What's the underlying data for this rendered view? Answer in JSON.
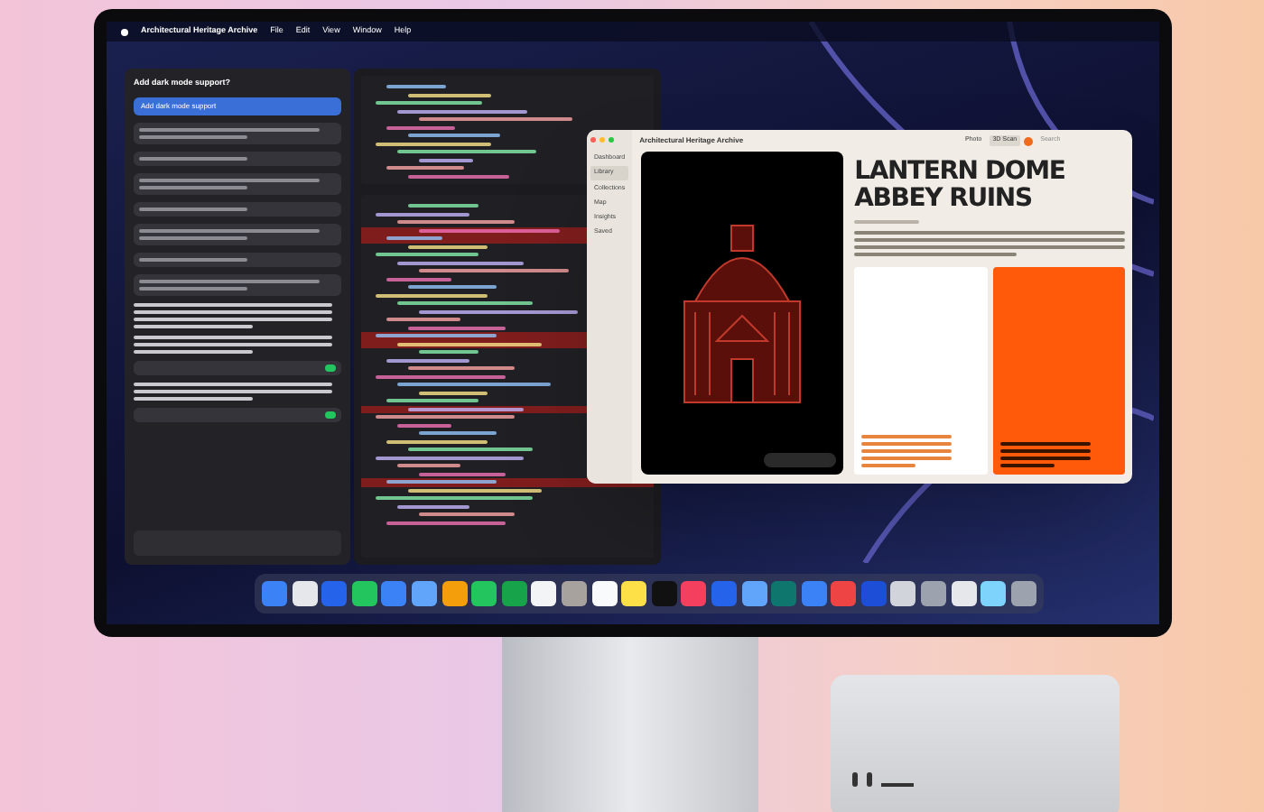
{
  "menu_bar": {
    "app": "Architectural Heritage Archive",
    "menus": [
      "File",
      "Edit",
      "View",
      "Window",
      "Help"
    ]
  },
  "assistant": {
    "heading": "Add dark mode support?",
    "prompt": "Add dark mode support"
  },
  "app_window": {
    "title": "Architectural Heritage Archive",
    "sidebar": [
      {
        "label": "Dashboard",
        "selected": false
      },
      {
        "label": "Library",
        "selected": true
      },
      {
        "label": "Collections",
        "selected": false
      },
      {
        "label": "Map",
        "selected": false
      },
      {
        "label": "Insights",
        "selected": false
      },
      {
        "label": "Saved",
        "selected": false
      }
    ],
    "view_toggle": [
      {
        "label": "Photo",
        "selected": false
      },
      {
        "label": "3D Scan",
        "selected": true
      }
    ],
    "search": {
      "placeholder": "Search"
    },
    "title_lines": [
      "LANTERN DOME",
      "ABBEY RUINS"
    ]
  },
  "dock": [
    {
      "color": "#3b82f6"
    },
    {
      "color": "#e5e7eb"
    },
    {
      "color": "#2563eb"
    },
    {
      "color": "#22c55e"
    },
    {
      "color": "#3b82f6"
    },
    {
      "color": "#60a5fa"
    },
    {
      "color": "#f59e0b"
    },
    {
      "color": "#22c55e"
    },
    {
      "color": "#16a34a"
    },
    {
      "color": "#f3f4f6"
    },
    {
      "color": "#a8a29e"
    },
    {
      "color": "#f9fafb"
    },
    {
      "color": "#fde047"
    },
    {
      "color": "#111111"
    },
    {
      "color": "#f43f5e"
    },
    {
      "color": "#2563eb"
    },
    {
      "color": "#60a5fa"
    },
    {
      "color": "#0f766e"
    },
    {
      "color": "#3b82f6"
    },
    {
      "color": "#ef4444"
    },
    {
      "color": "#1d4ed8"
    },
    {
      "color": "#d1d5db"
    },
    {
      "color": "#9ca3af"
    },
    {
      "color": "#e5e7eb"
    },
    {
      "color": "#7dd3fc"
    },
    {
      "color": "#9ca3af"
    }
  ]
}
